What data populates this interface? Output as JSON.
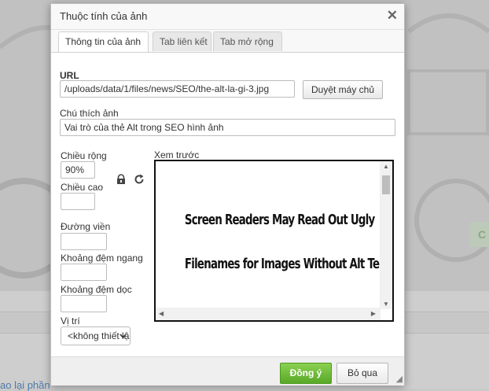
{
  "background": {
    "link_text": "ao lại phần",
    "badge_text": "C"
  },
  "dialog": {
    "title": "Thuộc tính của ảnh",
    "tabs": [
      {
        "label": "Thông tin của ảnh",
        "active": true
      },
      {
        "label": "Tab liên kết",
        "active": false
      },
      {
        "label": "Tab mở rộng",
        "active": false
      }
    ],
    "url": {
      "label": "URL",
      "value": "/uploads/data/1/files/news/SEO/the-alt-la-gi-3.jpg",
      "browse_button": "Duyệt máy chủ"
    },
    "alt": {
      "label": "Chú thích ảnh",
      "value": "Vai trò của thẻ Alt trong SEO hình ảnh"
    },
    "width": {
      "label": "Chiều rộng",
      "value": "90%"
    },
    "height": {
      "label": "Chiều cao",
      "value": ""
    },
    "border": {
      "label": "Đường viền",
      "value": ""
    },
    "hspace": {
      "label": "Khoảng đệm ngang",
      "value": ""
    },
    "vspace": {
      "label": "Khoảng đệm dọc",
      "value": ""
    },
    "align": {
      "label": "Vị trí",
      "selected": "<không thiết lập>"
    },
    "preview": {
      "label": "Xem trước",
      "line1": "Screen Readers May Read Out Ugly",
      "line2": "Filenames for Images Without Alt Text"
    },
    "footer": {
      "ok": "Đồng ý",
      "cancel": "Bỏ qua"
    }
  },
  "icons": {
    "close": "close-icon",
    "lock": "lock-icon",
    "reset": "reset-size-icon",
    "resize": "resize-grip-icon"
  },
  "colors": {
    "ok_button": "#6cb83a",
    "preview_border": "#111111"
  }
}
